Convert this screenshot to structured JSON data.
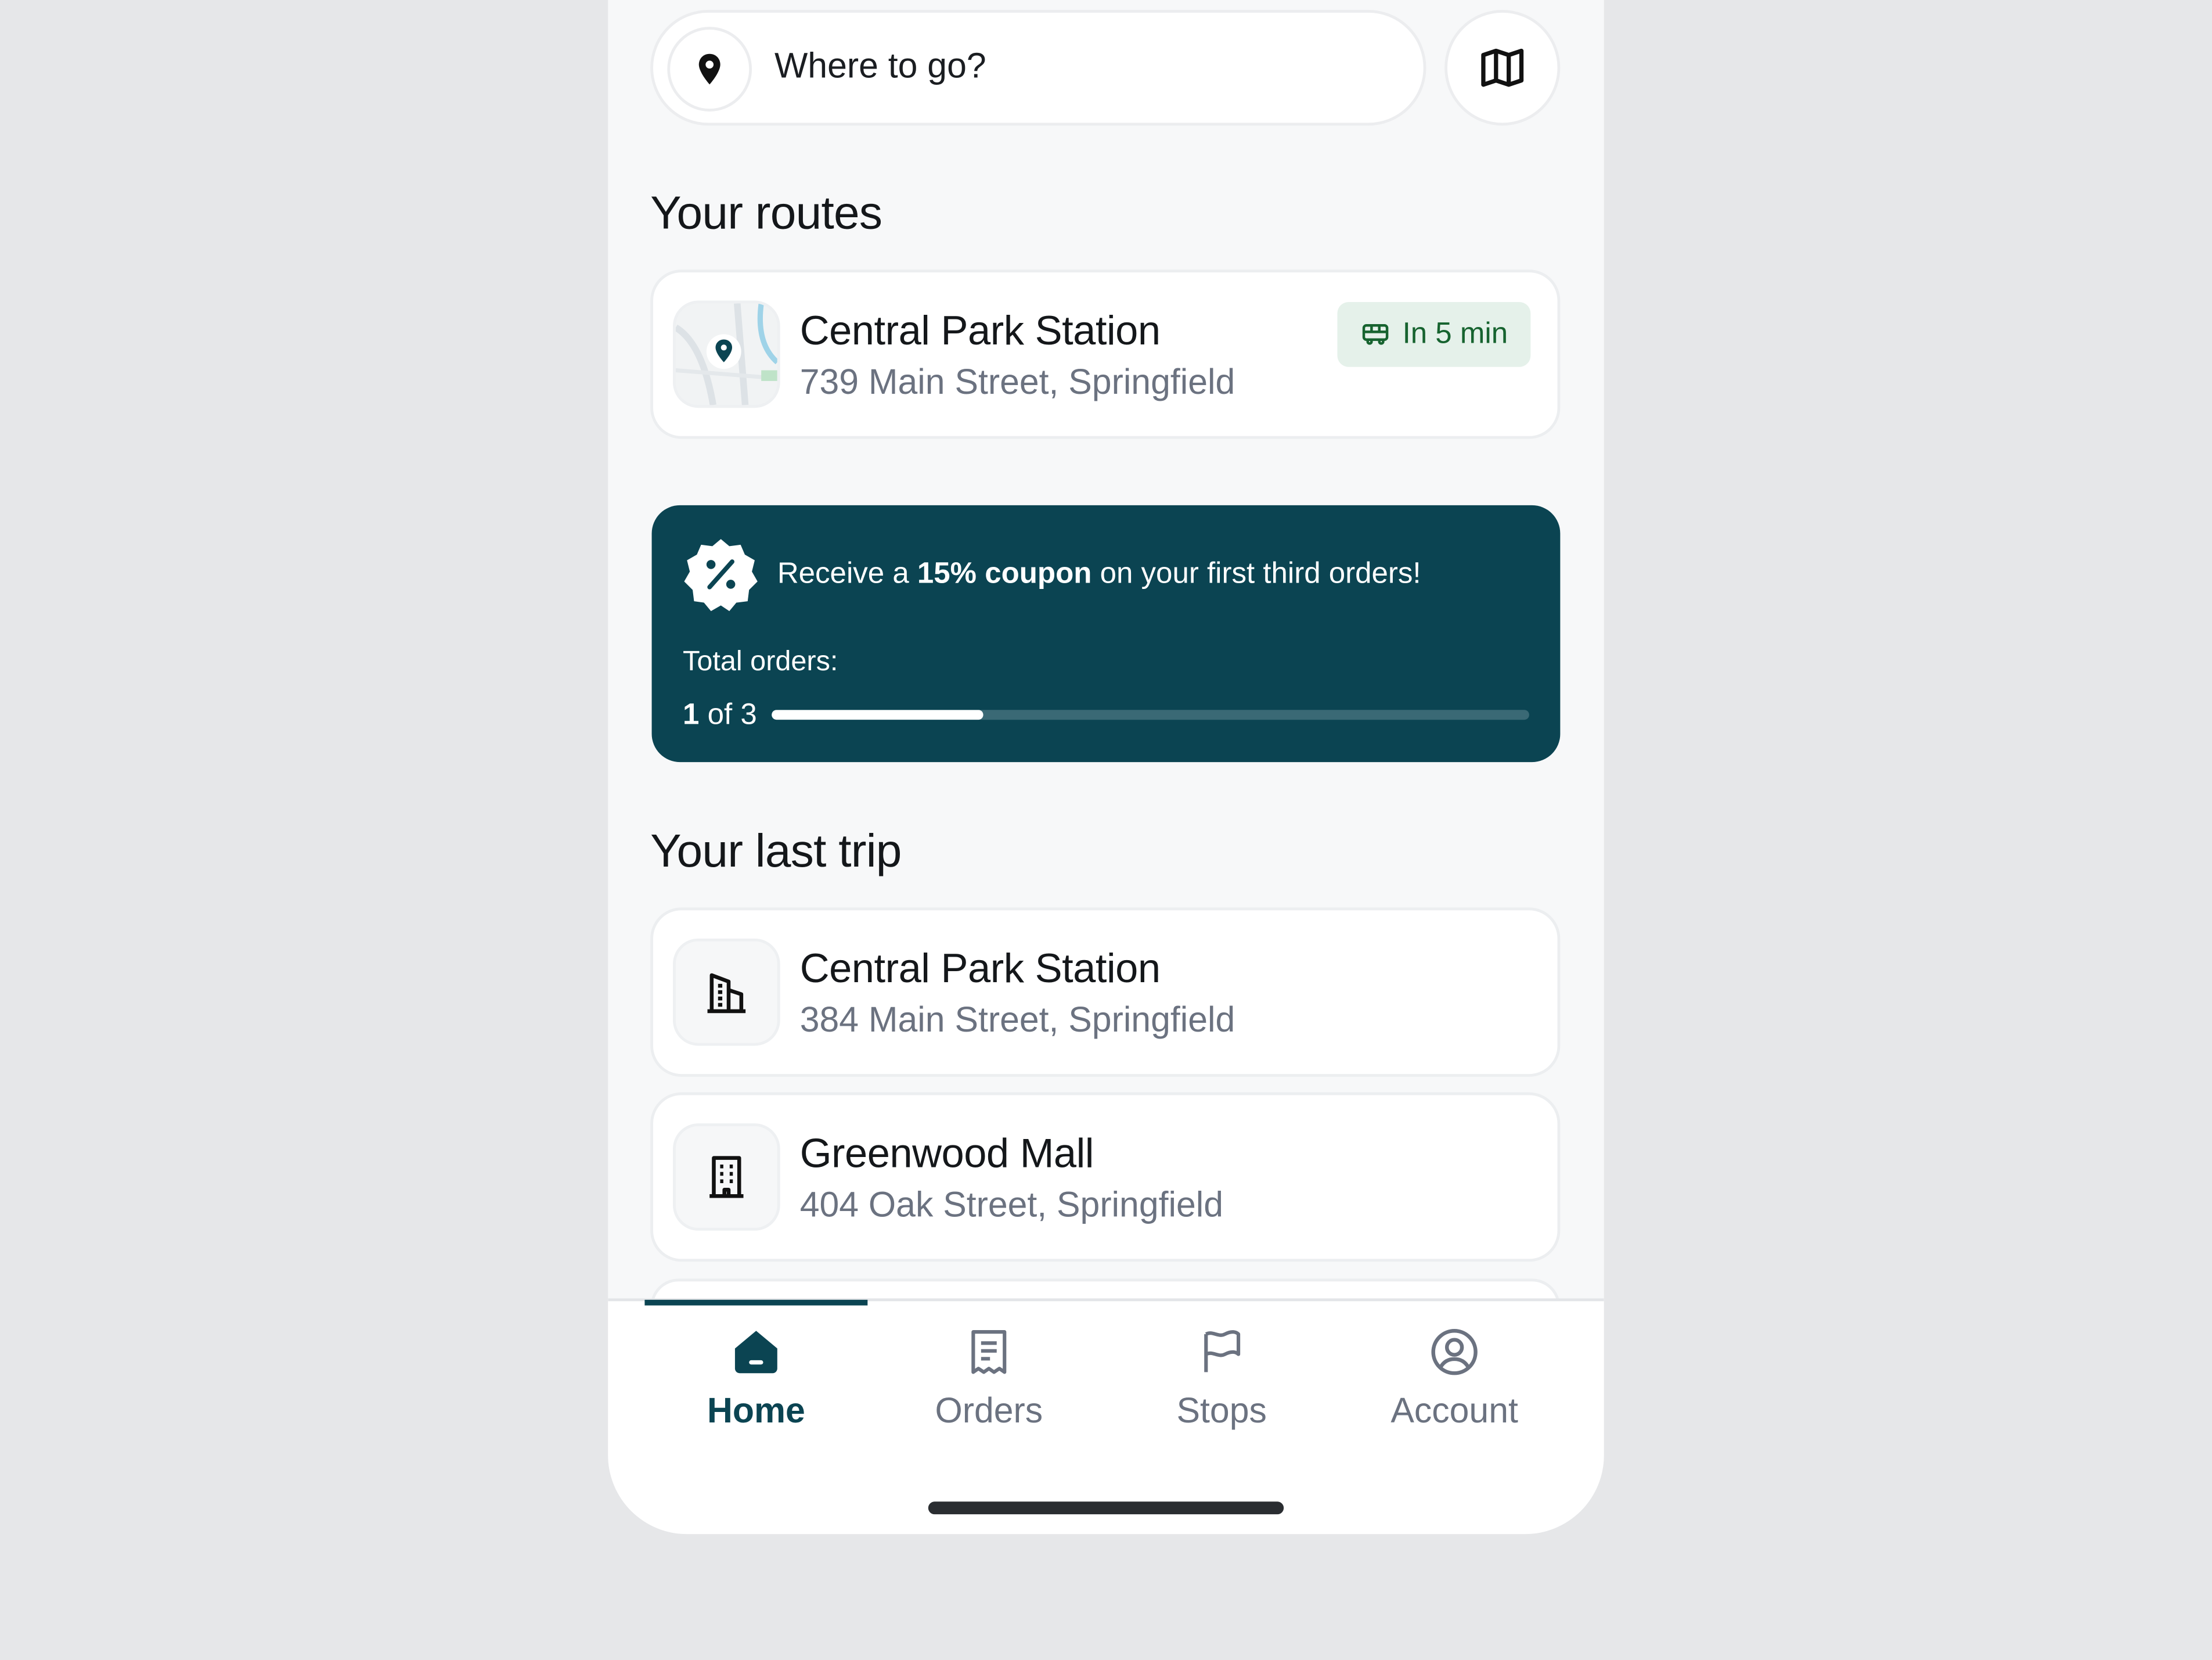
{
  "search": {
    "placeholder": "Where to go?",
    "pin_icon": "location-pin-icon",
    "map_icon": "map-icon"
  },
  "routes": {
    "title": "Your routes",
    "items": [
      {
        "name": "Central Park Station",
        "address": "739 Main Street, Springfield",
        "eta": "In 5 min",
        "eta_icon": "bus-icon"
      }
    ]
  },
  "promo": {
    "text_before": "Receive a ",
    "text_bold": "15% coupon",
    "text_after": " on your first third orders!",
    "total_label": "Total orders:",
    "count_current": "1",
    "count_rest": " of 3",
    "progress_fraction": 0.28,
    "icon": "discount-badge-icon"
  },
  "last_trip": {
    "title": "Your last trip",
    "items": [
      {
        "name": "Central Park Station",
        "address": "384 Main Street, Springfield",
        "icon": "building-icon"
      },
      {
        "name": "Greenwood Mall",
        "address": "404 Oak Street, Springfield",
        "icon": "office-building-icon"
      }
    ]
  },
  "tabbar": {
    "items": [
      {
        "label": "Home",
        "icon": "home-icon",
        "active": true
      },
      {
        "label": "Orders",
        "icon": "receipt-icon",
        "active": false
      },
      {
        "label": "Stops",
        "icon": "flag-icon",
        "active": false
      },
      {
        "label": "Account",
        "icon": "user-circle-icon",
        "active": false
      }
    ]
  },
  "colors": {
    "brand": "#0b4452",
    "eta_bg": "#e5f1ea",
    "eta_text": "#16632f",
    "muted_text": "#6b7280"
  }
}
